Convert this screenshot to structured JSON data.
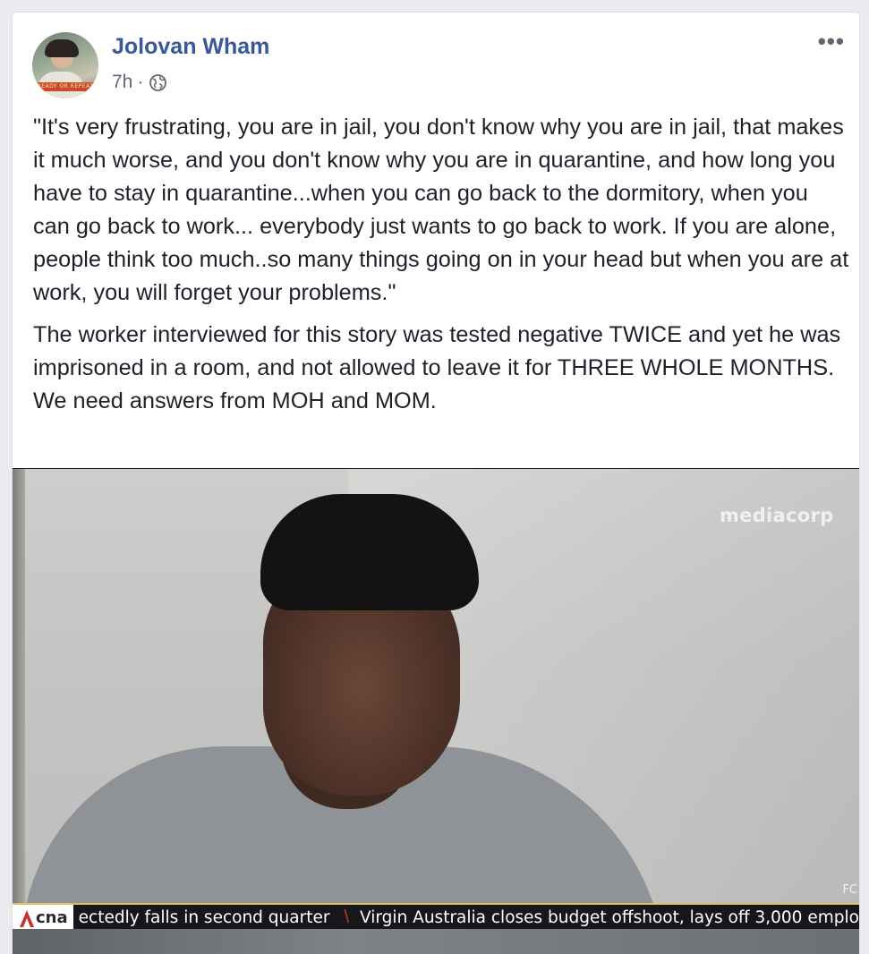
{
  "post": {
    "author": "Jolovan Wham",
    "time": "7h",
    "separator": "·",
    "avatar_caption": "READY OR REPEAT",
    "paragraphs": [
      "\"It's very frustrating, you are in jail, you don't know why you are in jail, that makes it much worse, and you don't know why you are in quarantine, and how long you have to stay in quarantine...when you can go back to the dormitory, when you can go back to work... everybody just wants to go back to work. If you are alone, people think too much..so many things going on in your head but when you are at work, you will forget your problems.\"",
      "The worker interviewed for this story was tested negative TWICE and yet he was imprisoned in a room, and not allowed to leave it for THREE WHOLE MONTHS. We need answers from MOH and MOM."
    ],
    "more_icon": "more-horizontal-icon",
    "privacy_icon": "globe-icon"
  },
  "video": {
    "watermark": "mediacorp",
    "corner_label": "FC",
    "ticker": {
      "logo_text": "cna",
      "logo_icon": "cna-a-logo-icon",
      "headline_1": "ectedly falls in second quarter",
      "separator": "\\",
      "headline_2": "Virgin Australia closes budget offshoot, lays off 3,000 emplo"
    }
  },
  "colors": {
    "author_name": "#385898",
    "meta_text": "#616770",
    "body_text": "#1d2129",
    "ticker_bg": "#15171a",
    "ticker_accent": "#c8322c"
  }
}
